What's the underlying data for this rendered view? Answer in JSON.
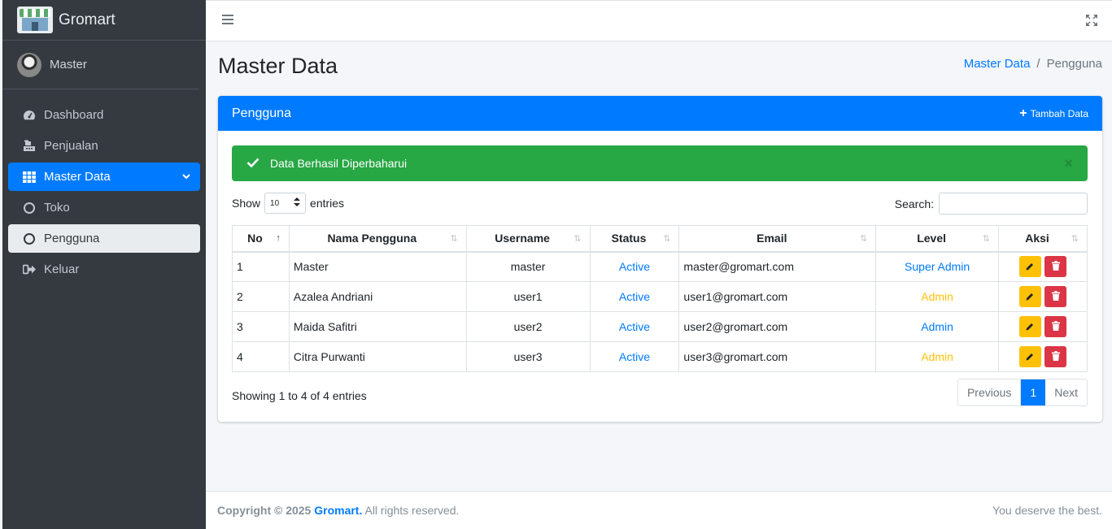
{
  "brand": {
    "name": "Gromart"
  },
  "user": {
    "name": "Master"
  },
  "sidebar": {
    "items": [
      {
        "label": "Dashboard",
        "icon": "tachometer-icon"
      },
      {
        "label": "Penjualan",
        "icon": "cash-register-icon"
      },
      {
        "label": "Master Data",
        "icon": "grid-icon",
        "active": true
      },
      {
        "label": "Toko",
        "icon": "circle-icon"
      },
      {
        "label": "Pengguna",
        "icon": "circle-icon",
        "selected": true
      },
      {
        "label": "Keluar",
        "icon": "sign-out-icon"
      }
    ]
  },
  "page": {
    "title": "Master Data"
  },
  "breadcrumb": {
    "parent": "Master Data",
    "separator": "/",
    "current": "Pengguna"
  },
  "card": {
    "title": "Pengguna",
    "add_label": "Tambah Data"
  },
  "alert": {
    "message": "Data Berhasil Diperbaharui",
    "close": "×"
  },
  "table_controls": {
    "show": "Show",
    "length": "10",
    "entries": "entries",
    "search_label": "Search:"
  },
  "table": {
    "columns": [
      "No",
      "Nama Pengguna",
      "Username",
      "Status",
      "Email",
      "Level",
      "Aksi"
    ],
    "rows": [
      {
        "no": "1",
        "name": "Master",
        "username": "master",
        "status": "Active",
        "email": "master@gromart.com",
        "level": "Super Admin",
        "level_color": "#007bff"
      },
      {
        "no": "2",
        "name": "Azalea Andriani",
        "username": "user1",
        "status": "Active",
        "email": "user1@gromart.com",
        "level": "Admin",
        "level_color": "#ffc107"
      },
      {
        "no": "3",
        "name": "Maida Safitri",
        "username": "user2",
        "status": "Active",
        "email": "user2@gromart.com",
        "level": "Admin",
        "level_color": "#007bff"
      },
      {
        "no": "4",
        "name": "Citra Purwanti",
        "username": "user3",
        "status": "Active",
        "email": "user3@gromart.com",
        "level": "Admin",
        "level_color": "#ffc107"
      }
    ]
  },
  "pagination": {
    "info": "Showing 1 to 4 of 4 entries",
    "previous": "Previous",
    "current": "1",
    "next": "Next"
  },
  "footer": {
    "copyright": "Copyright © 2025",
    "brand": "Gromart.",
    "rights": "All rights reserved.",
    "tagline": "You deserve the best."
  },
  "colors": {
    "primary": "#007bff",
    "success": "#28a745",
    "warning": "#ffc107",
    "danger": "#dc3545",
    "sidebar": "#343a40"
  }
}
